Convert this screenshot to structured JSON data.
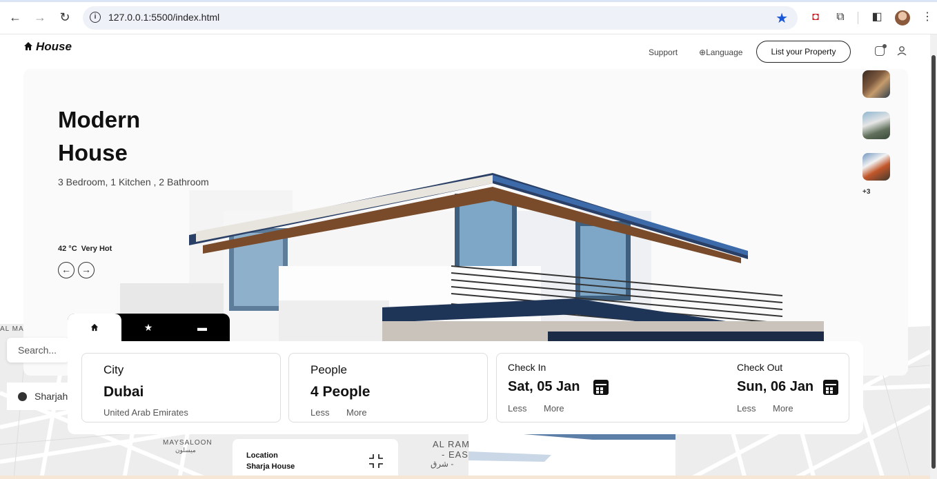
{
  "browser": {
    "url": "127.0.0.1:5500/index.html"
  },
  "header": {
    "logo": "House",
    "nav": {
      "support": "Support",
      "language": "Language",
      "list_property": "List your Property"
    }
  },
  "hero": {
    "title_line1": "Modern",
    "title_line2": "House",
    "subtitle": "3 Bedroom, 1 Kitchen , 2 Bathroom",
    "temperature": "42 °C",
    "weather": "Very Hot",
    "thumbs_more": "+3"
  },
  "sidebar": {
    "search_placeholder": "Search...",
    "location": "Sharjah"
  },
  "booking": {
    "city": {
      "label": "City",
      "value": "Dubai",
      "country": "United Arab Emirates"
    },
    "people": {
      "label": "People",
      "value": "4 People",
      "less": "Less",
      "more": "More"
    },
    "check_in": {
      "label": "Check In",
      "value": "Sat, 05 Jan",
      "less": "Less",
      "more": "More"
    },
    "check_out": {
      "label": "Check Out",
      "value": "Sun, 06 Jan",
      "less": "Less",
      "more": "More"
    }
  },
  "map": {
    "location_title": "Location",
    "location_name": "Sharja House",
    "label_maysaloon": "MAYSALOON",
    "label_maysaloon_ar": "ميسلون",
    "label_alram": "AL RAM",
    "label_eas": "- EAS",
    "label_ar": "شرق -",
    "label_alma": "AL MA"
  },
  "colors": {
    "accent": "#000000",
    "bookmark_star": "#1a57d6"
  }
}
